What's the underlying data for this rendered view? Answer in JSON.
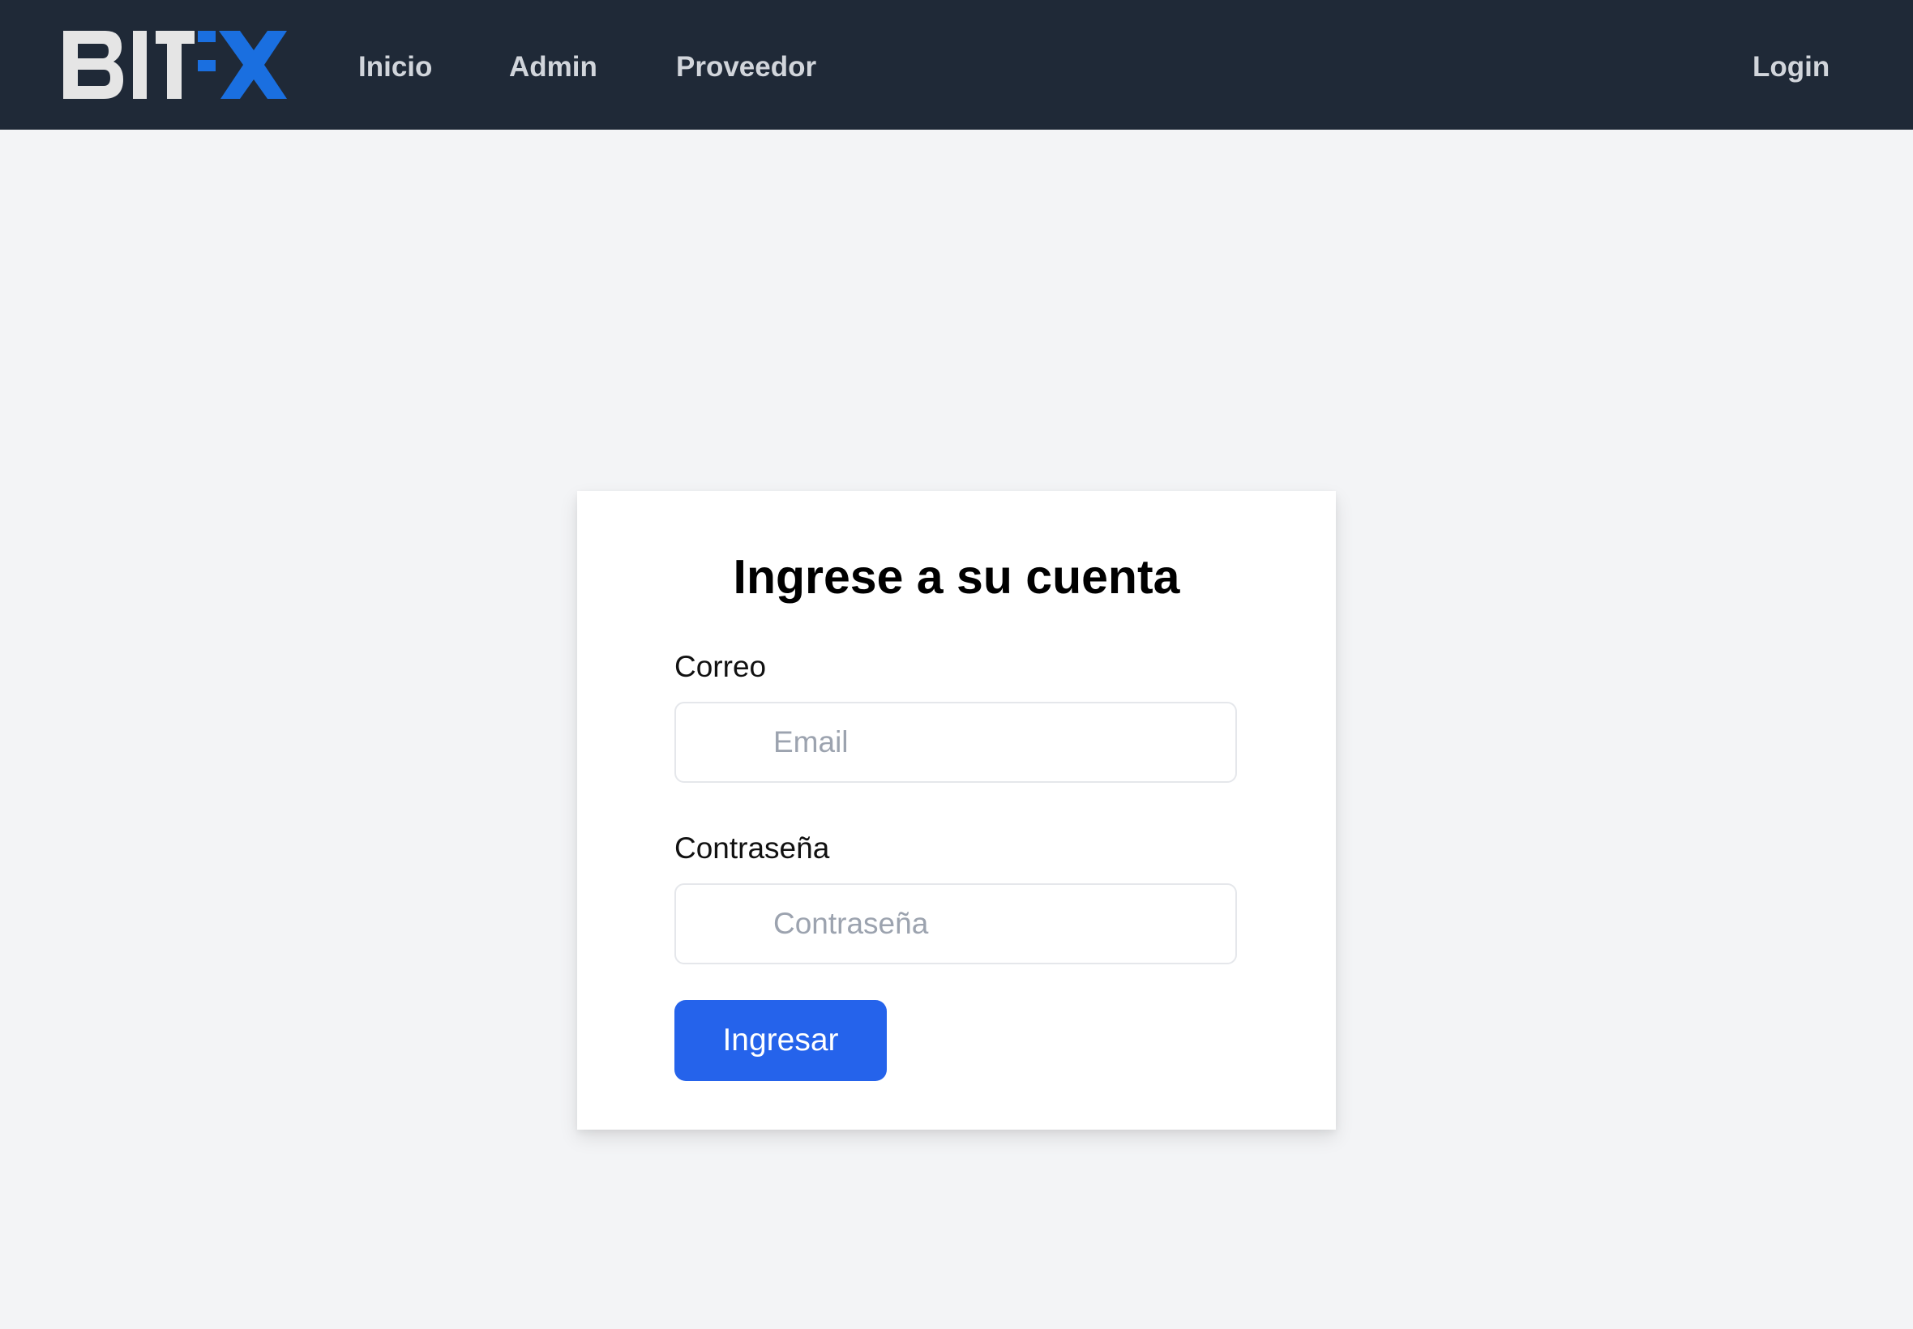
{
  "brand": {
    "name": "BITFX",
    "colors": {
      "navbar_bg": "#1f2937",
      "logo_gray": "#e5e5e5",
      "logo_blue": "#1a6fe0",
      "accent": "#2563eb",
      "page_bg": "#f3f4f6"
    }
  },
  "nav": {
    "links": [
      {
        "label": "Inicio"
      },
      {
        "label": "Admin"
      },
      {
        "label": "Proveedor"
      }
    ],
    "login_label": "Login"
  },
  "login_form": {
    "title": "Ingrese a su cuenta",
    "email": {
      "label": "Correo",
      "placeholder": "Email",
      "value": ""
    },
    "password": {
      "label": "Contraseña",
      "placeholder": "Contraseña",
      "value": ""
    },
    "submit_label": "Ingresar"
  }
}
